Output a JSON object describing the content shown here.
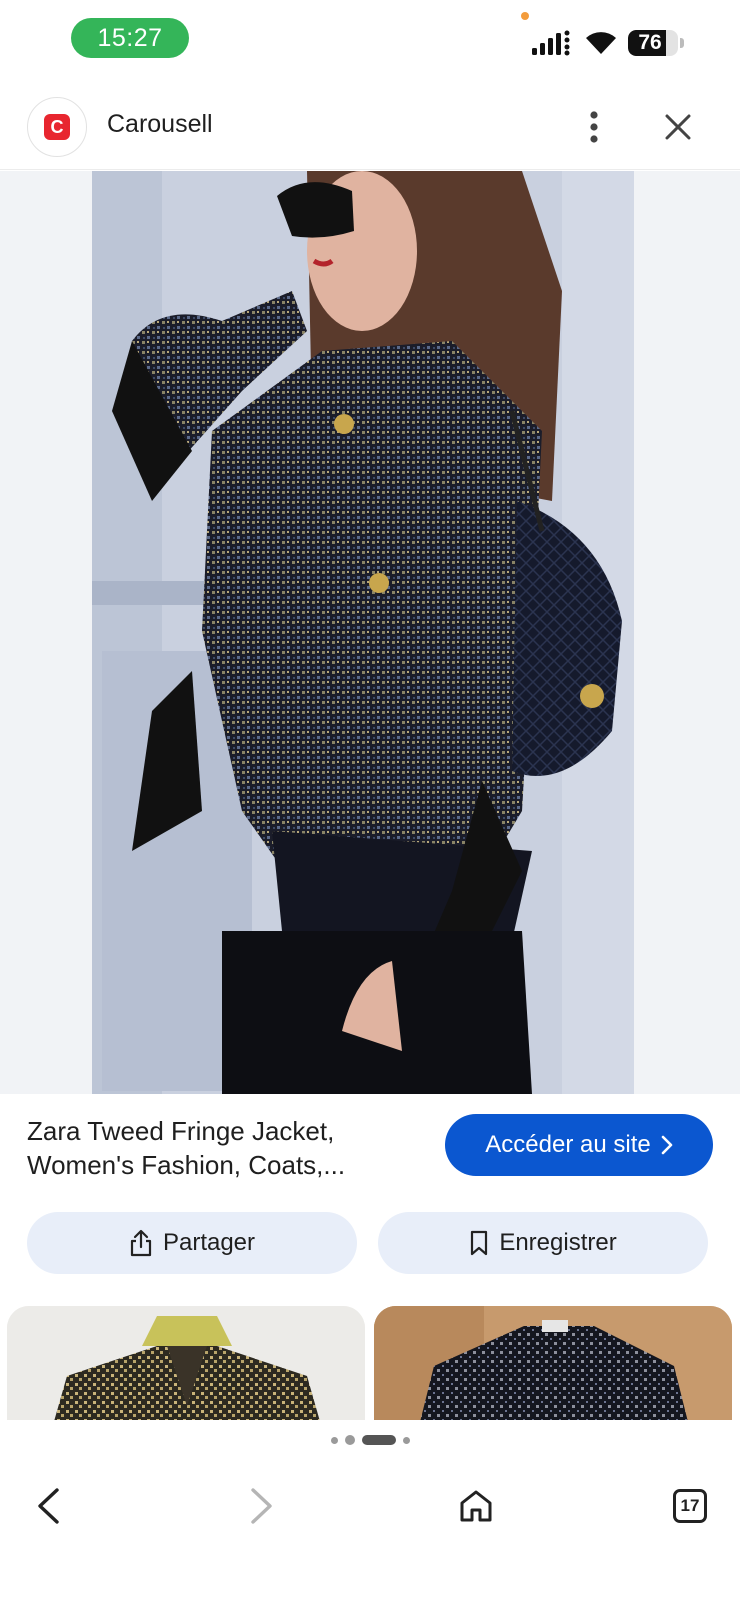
{
  "status_bar": {
    "time": "15:27",
    "battery_level": "76",
    "battery_fraction": 0.76,
    "signal_icon": "cellular-signal-icon",
    "wifi_icon": "wifi-icon"
  },
  "header": {
    "site_name": "Carousell",
    "favicon_letter": "C",
    "brand_color": "#e8262f",
    "more_icon": "more-vert-icon",
    "close_icon": "close-icon"
  },
  "result": {
    "title": "Zara Tweed Fringe Jacket, Women's Fashion, Coats,...",
    "visit_label": "Accéder au site",
    "visit_icon": "chevron-right-icon",
    "accent_color": "#0b57d0"
  },
  "actions": {
    "share_label": "Partager",
    "share_icon": "share-icon",
    "save_label": "Enregistrer",
    "save_icon": "bookmark-icon"
  },
  "carousel": {
    "dot_count": 5,
    "active_index": 2
  },
  "bottom_nav": {
    "back_icon": "arrow-back-icon",
    "forward_icon": "arrow-forward-icon",
    "home_icon": "home-icon",
    "tabs_count": "17"
  }
}
